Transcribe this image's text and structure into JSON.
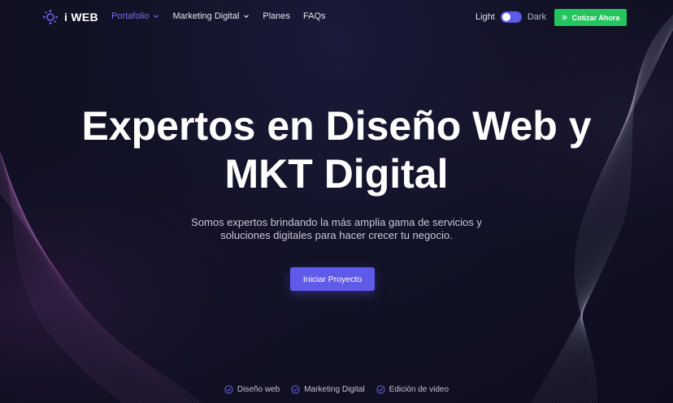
{
  "brand": {
    "logo_text": "i WEB"
  },
  "nav": {
    "items": [
      {
        "label": "Portafolio",
        "has_dropdown": true,
        "active": true
      },
      {
        "label": "Marketing Digital",
        "has_dropdown": true,
        "active": false
      },
      {
        "label": "Planes",
        "has_dropdown": false,
        "active": false
      },
      {
        "label": "FAQs",
        "has_dropdown": false,
        "active": false
      }
    ]
  },
  "theme": {
    "light_label": "Light",
    "dark_label": "Dark",
    "selected": "Dark"
  },
  "cta": {
    "label": "Cotizar Ahora",
    "icon": "double-chevron-right-icon"
  },
  "hero": {
    "title_line1": "Expertos en Diseño Web y",
    "title_line2": "MKT Digital",
    "subtitle_line1": "Somos expertos brindando la más amplia gama de servicios y",
    "subtitle_line2": "soluciones digitales para hacer crecer tu negocio.",
    "button_label": "Iniciar Proyecto"
  },
  "features": [
    {
      "label": "Diseño web",
      "icon": "check-circle-icon"
    },
    {
      "label": "Marketing Digital",
      "icon": "check-circle-icon"
    },
    {
      "label": "Edición de video",
      "icon": "check-circle-icon"
    }
  ],
  "colors": {
    "background": "#121226",
    "accent": "#5f5ae8",
    "active_link": "#7b6df7",
    "cta_green": "#22c55e",
    "wave_left": "#b06ab8",
    "wave_right": "#8a8aa0"
  }
}
